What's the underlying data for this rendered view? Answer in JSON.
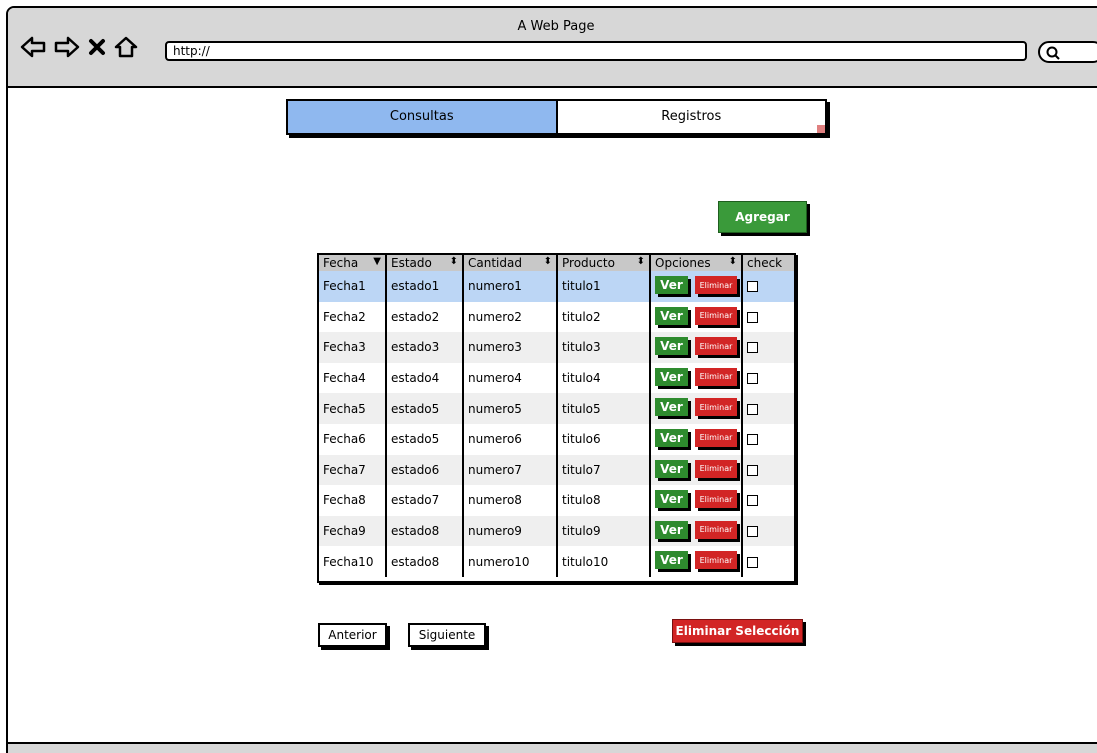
{
  "browser": {
    "title": "A Web Page",
    "url": "http://"
  },
  "tabs": [
    {
      "label": "Consultas",
      "active": true
    },
    {
      "label": "Registros",
      "active": false
    }
  ],
  "actions": {
    "agregar": "Agregar",
    "anterior": "Anterior",
    "siguiente": "Siguiente",
    "eliminar_seleccion": "Eliminar Selección"
  },
  "table": {
    "columns": [
      "Fecha",
      "Estado",
      "Cantidad",
      "Producto",
      "Opciones",
      "check"
    ],
    "ver_label": "Ver",
    "eliminar_label": "Eliminar",
    "rows": [
      {
        "fecha": "Fecha1",
        "estado": "estado1",
        "cantidad": "numero1",
        "producto": "titulo1"
      },
      {
        "fecha": "Fecha2",
        "estado": "estado2",
        "cantidad": "numero2",
        "producto": "titulo2"
      },
      {
        "fecha": "Fecha3",
        "estado": "estado3",
        "cantidad": "numero3",
        "producto": "titulo3"
      },
      {
        "fecha": "Fecha4",
        "estado": "estado4",
        "cantidad": "numero4",
        "producto": "titulo4"
      },
      {
        "fecha": "Fecha5",
        "estado": "estado5",
        "cantidad": "numero5",
        "producto": "titulo5"
      },
      {
        "fecha": "Fecha6",
        "estado": "estado5",
        "cantidad": "numero6",
        "producto": "titulo6"
      },
      {
        "fecha": "Fecha7",
        "estado": "estado6",
        "cantidad": "numero7",
        "producto": "titulo7"
      },
      {
        "fecha": "Fecha8",
        "estado": "estado7",
        "cantidad": "numero8",
        "producto": "titulo8"
      },
      {
        "fecha": "Fecha9",
        "estado": "estado8",
        "cantidad": "numero9",
        "producto": "titulo9"
      },
      {
        "fecha": "Fecha10",
        "estado": "estado8",
        "cantidad": "numero10",
        "producto": "titulo10"
      }
    ]
  },
  "colors": {
    "tab_active": "#8fb8ef",
    "green": "#3a9a3a",
    "red": "#d22525",
    "row_selected": "#bcd6f5"
  }
}
